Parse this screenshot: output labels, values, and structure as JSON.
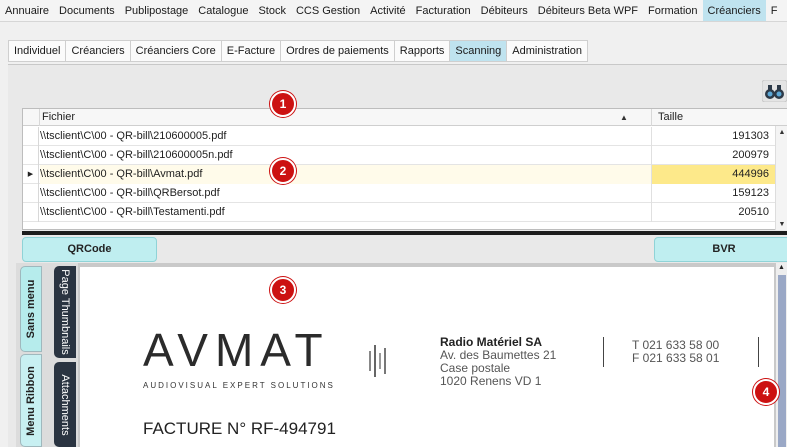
{
  "top_menu": {
    "items": [
      "Annuaire",
      "Documents",
      "Publipostage",
      "Catalogue",
      "Stock",
      "CCS Gestion",
      "Activité",
      "Facturation",
      "Débiteurs",
      "Débiteurs Beta WPF",
      "Formation",
      "Créanciers",
      "F"
    ],
    "active": "Créanciers"
  },
  "sub_tabs": {
    "items": [
      "Individuel",
      "Créanciers",
      "Créanciers Core",
      "E-Facture",
      "Ordres de paiements",
      "Rapports",
      "Scanning",
      "Administration"
    ],
    "active": "Scanning"
  },
  "grid": {
    "columns": [
      "Fichier",
      "Taille"
    ],
    "rows": [
      {
        "fichier": "\\\\tsclient\\C\\00 - QR-bill\\210600005.pdf",
        "taille": "191303"
      },
      {
        "fichier": "\\\\tsclient\\C\\00 - QR-bill\\210600005n.pdf",
        "taille": "200979"
      },
      {
        "fichier": "\\\\tsclient\\C\\00 - QR-bill\\Avmat.pdf",
        "taille": "444996"
      },
      {
        "fichier": "\\\\tsclient\\C\\00 - QR-bill\\QRBersot.pdf",
        "taille": "159123"
      },
      {
        "fichier": "\\\\tsclient\\C\\00 - QR-bill\\Testamenti.pdf",
        "taille": "20510"
      }
    ],
    "selected_row": 2
  },
  "buttons": {
    "qrcode": "QRCode",
    "bvr": "BVR"
  },
  "side_tabs": {
    "sans_menu": "Sans menu",
    "menu_ribbon": "Menu Ribbon",
    "page_thumbnails": "Page Thumbnails",
    "attachments": "Attachments"
  },
  "document": {
    "logo": "AVMAT",
    "logo_sub": "AUDIOVISUAL EXPERT SOLUTIONS",
    "company": "Radio Matériel SA",
    "address": [
      "Av. des Baumettes 21",
      "Case postale",
      "1020 Renens VD 1"
    ],
    "phones": [
      "T 021 633 58 00",
      "F 021 633 58 01"
    ],
    "invoice_title": "FACTURE N° RF-494791"
  },
  "markers": [
    "1",
    "2",
    "3",
    "4"
  ],
  "colors": {
    "active_tab": "#bfe3ef",
    "selected_cell": "#fde98a",
    "button": "#bfeef0",
    "marker": "#cc1111",
    "side_tab_dark": "#2a3441"
  }
}
